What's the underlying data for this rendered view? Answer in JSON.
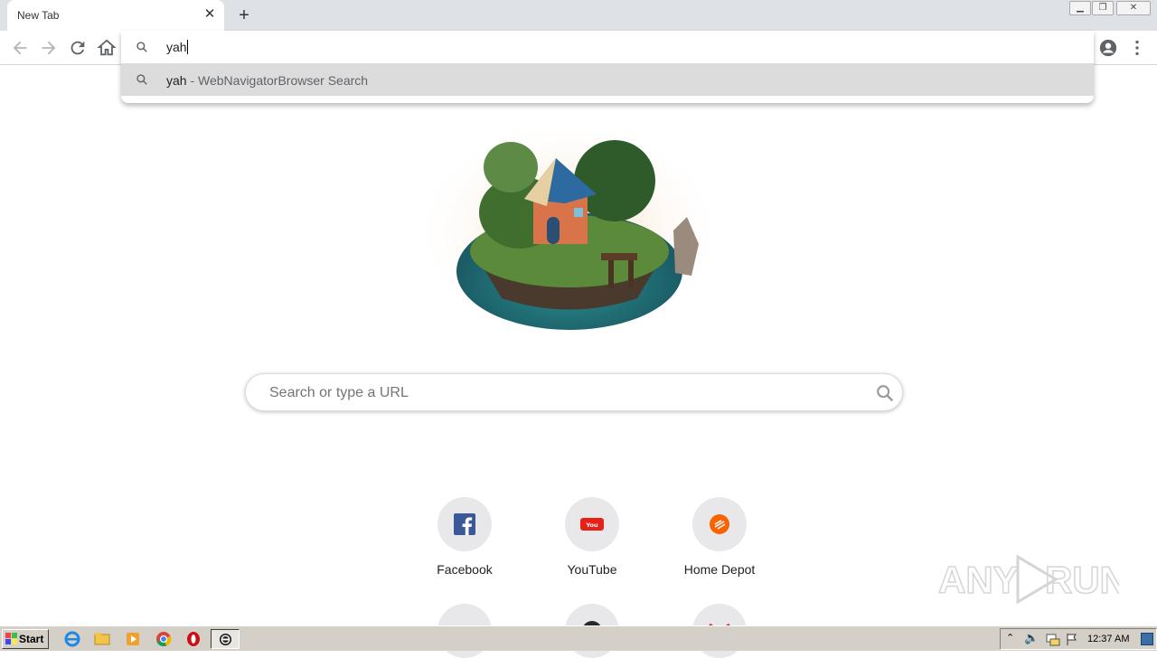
{
  "tab": {
    "title": "New Tab"
  },
  "omnibox": {
    "typed_text": "yah",
    "suggestion_query": "yah",
    "suggestion_suffix": " - WebNavigatorBrowser Search"
  },
  "search": {
    "placeholder": "Search or type a URL"
  },
  "shortcuts": [
    {
      "label": "Facebook",
      "icon": "facebook-icon"
    },
    {
      "label": "YouTube",
      "icon": "youtube-icon"
    },
    {
      "label": "Home Depot",
      "icon": "home-depot-icon"
    }
  ],
  "taskbar": {
    "start_label": "Start",
    "clock": "12:37 AM"
  },
  "watermark": {
    "text": "ANY RUN"
  },
  "colors": {
    "tabstrip": "#dee1e6",
    "suggestion_highlight": "#dcdcdc",
    "facebook": "#3b5998",
    "youtube": "#e62117",
    "home_depot": "#f96302"
  }
}
